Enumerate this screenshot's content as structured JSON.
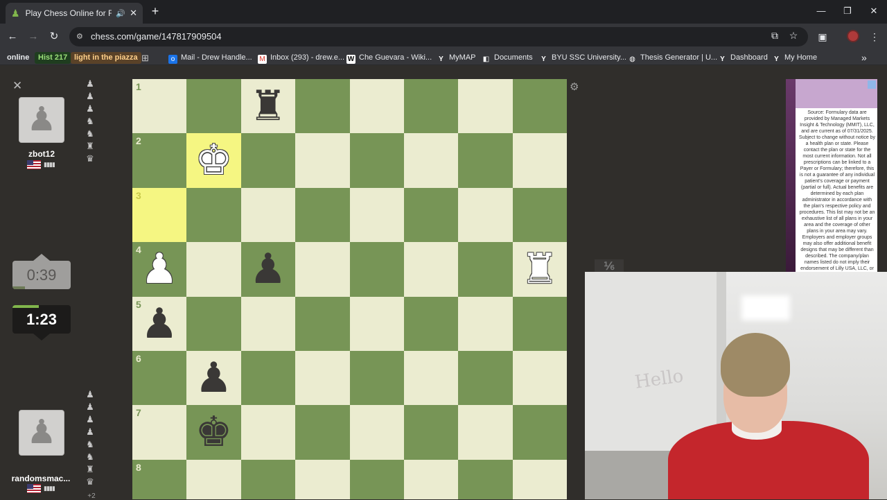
{
  "browser": {
    "tab_title": "Play Chess Online for FREE",
    "url": "chess.com/game/147817909504",
    "bookmarks": [
      {
        "label": "online",
        "style": "plain"
      },
      {
        "label": "Hist 217",
        "style": "chip-green"
      },
      {
        "label": "light in the piazza",
        "style": "chip-tan"
      },
      {
        "label": "Mail - Drew Handle...",
        "icon": "outlook-icon"
      },
      {
        "label": "Inbox (293) - drew.e...",
        "icon": "gmail-icon"
      },
      {
        "label": "Che Guevara - Wiki...",
        "icon": "wikipedia-icon"
      },
      {
        "label": "MyMAP",
        "icon": "byu-icon"
      },
      {
        "label": "Documents",
        "icon": "docs-icon"
      },
      {
        "label": "BYU SSC University...",
        "icon": "byu-icon"
      },
      {
        "label": "Thesis Generator | U...",
        "icon": "globe-icon"
      },
      {
        "label": "Dashboard",
        "icon": "byu-icon"
      },
      {
        "label": "My Home",
        "icon": "byu-icon"
      }
    ]
  },
  "players": {
    "top": {
      "name": "zbot12",
      "clock": "0:39",
      "captured": [
        "♟",
        "♟",
        "♟",
        "♞",
        "♞",
        "♜",
        "♛"
      ]
    },
    "bottom": {
      "name": "randomsmac...",
      "clock": "1:23",
      "captured": [
        "♟",
        "♟",
        "♟",
        "♟",
        "♞",
        "♞",
        "♜",
        "♛"
      ],
      "advantage": "+2"
    }
  },
  "board": {
    "ranks": [
      "1",
      "2",
      "3",
      "4",
      "5",
      "6",
      "7",
      "8"
    ],
    "highlighted": [
      "b2",
      "a3"
    ],
    "pieces": [
      {
        "square": "c1",
        "color": "b",
        "symbol": "♜",
        "name": "black-rook"
      },
      {
        "square": "b2",
        "color": "w",
        "symbol": "♚",
        "name": "white-king"
      },
      {
        "square": "a4",
        "color": "w",
        "symbol": "♟",
        "name": "white-pawn"
      },
      {
        "square": "c4",
        "color": "b",
        "symbol": "♟",
        "name": "black-pawn"
      },
      {
        "square": "h4",
        "color": "w",
        "symbol": "♜",
        "name": "white-rook"
      },
      {
        "square": "a5",
        "color": "b",
        "symbol": "♟",
        "name": "black-pawn"
      },
      {
        "square": "b6",
        "color": "b",
        "symbol": "♟",
        "name": "black-pawn"
      },
      {
        "square": "b7",
        "color": "b",
        "symbol": "♚",
        "name": "black-king"
      }
    ]
  },
  "ad": {
    "text": "Source: Formulary data are provided by Managed Markets Insight & Technology (MMIT), LLC, and are current as of 07/31/2025. Subject to change without notice by a health plan or state. Please contact the plan or state for the most current information. Not all prescriptions can be linked to a Payer or Formulary; therefore, this is not a guarantee of any individual patient's coverage or payment (partial or full). Actual benefits are determined by each plan administrator in accordance with the plan's respective policy and procedures. This list may not be an exhaustive list of all plans in your area and the coverage of other plans in your area may vary. Employers and employer groups may also offer additional benefit designs that may be different than described. The company/plan names listed do not imply their endorsement of Lilly USA, LLC, or the product(s)"
  },
  "webcam": {
    "whiteboard_text": "Hello"
  }
}
